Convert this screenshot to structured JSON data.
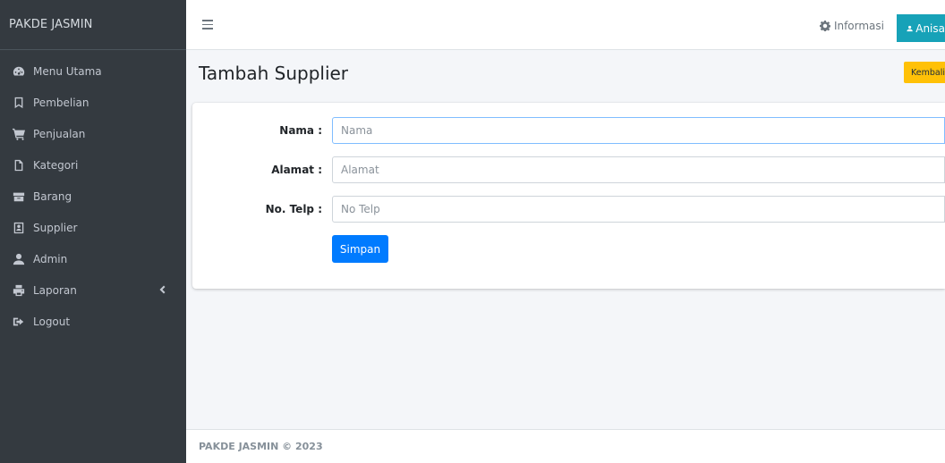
{
  "brand": "PAKDE JASMIN",
  "sidebar": {
    "items": [
      {
        "label": "Menu Utama",
        "icon": "dashboard-icon"
      },
      {
        "label": "Pembelian",
        "icon": "bookmark-icon"
      },
      {
        "label": "Penjualan",
        "icon": "cart-icon"
      },
      {
        "label": "Kategori",
        "icon": "file-icon"
      },
      {
        "label": "Barang",
        "icon": "box-icon"
      },
      {
        "label": "Supplier",
        "icon": "contact-card-icon"
      },
      {
        "label": "Admin",
        "icon": "user-icon"
      },
      {
        "label": "Laporan",
        "icon": "printer-icon"
      },
      {
        "label": "Logout",
        "icon": "sign-out-icon"
      }
    ]
  },
  "topbar": {
    "info_label": "Informasi",
    "user_label": "Anisa"
  },
  "page": {
    "title": "Tambah Supplier",
    "back_label": "Kembali"
  },
  "form": {
    "nama": {
      "label": "Nama :",
      "placeholder": "Nama",
      "value": ""
    },
    "alamat": {
      "label": "Alamat :",
      "placeholder": "Alamat",
      "value": ""
    },
    "telp": {
      "label": "No. Telp :",
      "placeholder": "No Telp",
      "value": ""
    },
    "submit_label": "Simpan"
  },
  "footer": {
    "text": "PAKDE JASMIN © 2023"
  },
  "colors": {
    "sidebar_bg": "#343a40",
    "info_btn": "#17a2b8",
    "warning_btn": "#ffc107",
    "primary_btn": "#007bff"
  }
}
